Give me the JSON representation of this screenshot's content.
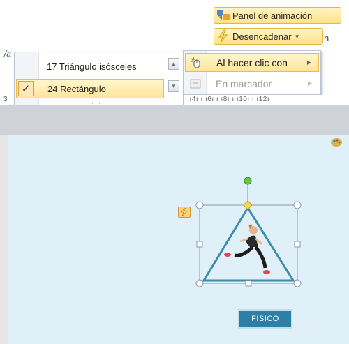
{
  "ribbon": {
    "panel_label": "Panel de animación",
    "trigger_label": "Desencadenar",
    "partial_right": "n",
    "partial_left": "/a",
    "partial_left_ruler": "3"
  },
  "shape_list": {
    "items": [
      {
        "label": "17 Triángulo isósceles",
        "selected": false
      },
      {
        "label": "24 Rectángulo",
        "selected": true
      }
    ],
    "grip": "····"
  },
  "trigger_menu": {
    "items": [
      {
        "label": "Al hacer clic con",
        "enabled": true
      },
      {
        "label": "En marcador",
        "enabled": false
      }
    ]
  },
  "ruler": {
    "text": "ı ı4ı ı ı6ı ı ı8ı ı ı10ı ı ı12ı"
  },
  "slide": {
    "button_label": "FISICO"
  },
  "colors": {
    "slide_bg": "#dff0f8",
    "button_bg": "#2c7fa6",
    "highlight": "#ffe59a",
    "triangle_stroke": "#3d8ca8"
  },
  "icons": {
    "panel": "animation-pane-icon",
    "trigger": "lightning-icon",
    "click": "mouse-click-icon",
    "bookmark": "bookmark-icon"
  }
}
